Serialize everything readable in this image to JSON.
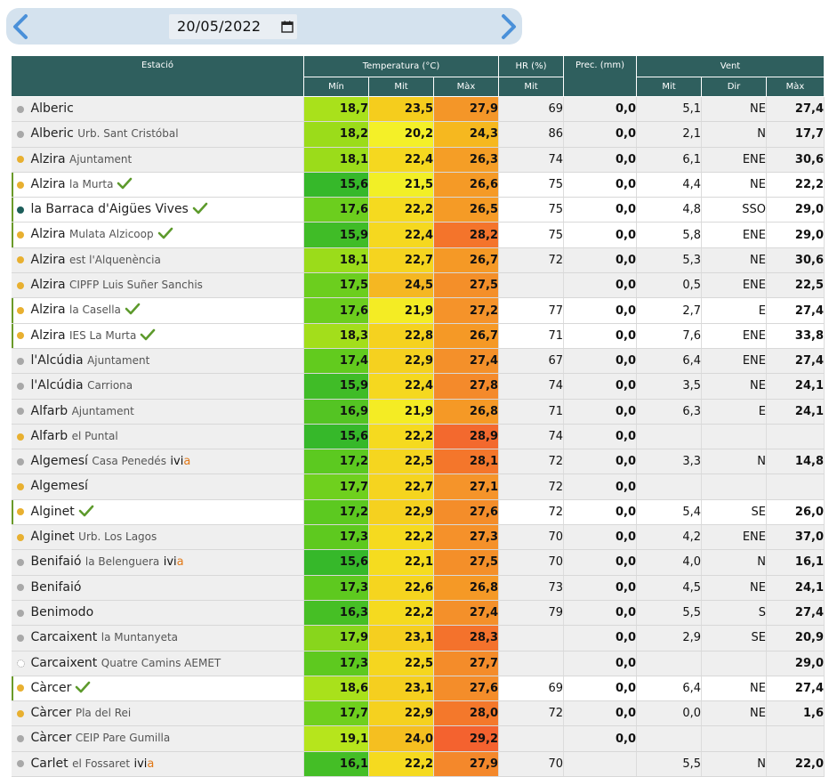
{
  "date_picker": {
    "value": "20/05/2022",
    "prev_icon": "chevron-left-icon",
    "next_icon": "chevron-right-icon",
    "calendar_icon": "calendar-icon",
    "accent_color": "#4a90d9"
  },
  "table": {
    "headers": {
      "station": "Estació",
      "temperature": "Temperatura (°C)",
      "humidity": "HR (%)",
      "precip": "Prec. (mm)",
      "wind": "Vent"
    },
    "subheaders": {
      "temp_min": "Mín",
      "temp_avg": "Mit",
      "temp_max": "Màx",
      "hr_avg": "Mit",
      "wind_avg": "Mit",
      "wind_dir": "Dir",
      "wind_max": "Màx"
    },
    "status_colors": {
      "gray": "#a8a8a8",
      "orange": "#e8b030",
      "teal": "#1d5e5a",
      "empty": "#ffffff"
    },
    "rows": [
      {
        "name": "Alberic",
        "sub": "",
        "status": "gray",
        "sel": false,
        "check": false,
        "ivia": false,
        "min": "18,7",
        "mit": "23,5",
        "max": "27,9",
        "min_color": "#a9e11b",
        "mit_color": "#f5cd1d",
        "max_color": "#f49628",
        "hr": "69",
        "prec": "0,0",
        "wmit": "5,1",
        "wdir": "NE",
        "wmax": "27,4"
      },
      {
        "name": "Alberic",
        "sub": "Urb. Sant Cristóbal",
        "status": "gray",
        "sel": false,
        "check": false,
        "ivia": false,
        "min": "18,2",
        "mit": "20,2",
        "max": "24,3",
        "min_color": "#9bdc1a",
        "mit_color": "#f4f028",
        "max_color": "#f6b81f",
        "hr": "86",
        "prec": "0,0",
        "wmit": "2,1",
        "wdir": "N",
        "wmax": "17,7"
      },
      {
        "name": "Alzira",
        "sub": "Ajuntament",
        "status": "orange",
        "sel": false,
        "check": false,
        "ivia": false,
        "min": "18,1",
        "mit": "22,4",
        "max": "26,3",
        "min_color": "#9bdc1a",
        "mit_color": "#f5d81f",
        "max_color": "#f59e26",
        "hr": "74",
        "prec": "0,0",
        "wmit": "6,1",
        "wdir": "ENE",
        "wmax": "30,6"
      },
      {
        "name": "Alzira",
        "sub": "la Murta",
        "status": "orange",
        "sel": true,
        "check": true,
        "ivia": false,
        "min": "15,6",
        "mit": "21,5",
        "max": "26,6",
        "min_color": "#36b82a",
        "mit_color": "#f2ef26",
        "max_color": "#f59a26",
        "hr": "75",
        "prec": "0,0",
        "wmit": "4,4",
        "wdir": "NE",
        "wmax": "22,2"
      },
      {
        "name": "la Barraca d'Aigües Vives",
        "sub": "",
        "status": "teal",
        "sel": true,
        "check": true,
        "ivia": false,
        "min": "17,6",
        "mit": "22,2",
        "max": "26,5",
        "min_color": "#6cce1e",
        "mit_color": "#f5da1f",
        "max_color": "#f59b26",
        "hr": "75",
        "prec": "0,0",
        "wmit": "4,8",
        "wdir": "SSO",
        "wmax": "29,0"
      },
      {
        "name": "Alzira",
        "sub": "Mulata Alzicoop",
        "status": "orange",
        "sel": true,
        "check": true,
        "ivia": false,
        "min": "15,9",
        "mit": "22,4",
        "max": "28,2",
        "min_color": "#40bc27",
        "mit_color": "#f5d81f",
        "max_color": "#f4742b",
        "hr": "75",
        "prec": "0,0",
        "wmit": "5,8",
        "wdir": "ENE",
        "wmax": "29,0"
      },
      {
        "name": "Alzira",
        "sub": "est l'Alquenència",
        "status": "orange",
        "sel": false,
        "check": false,
        "ivia": false,
        "min": "18,1",
        "mit": "22,7",
        "max": "26,7",
        "min_color": "#9bdc1a",
        "mit_color": "#f5d41f",
        "max_color": "#f59926",
        "hr": "72",
        "prec": "0,0",
        "wmit": "5,3",
        "wdir": "NE",
        "wmax": "30,6"
      },
      {
        "name": "Alzira",
        "sub": "CIPFP Luis Suñer Sanchis",
        "status": "orange",
        "sel": false,
        "check": false,
        "ivia": false,
        "min": "17,5",
        "mit": "24,5",
        "max": "27,5",
        "min_color": "#6cce1e",
        "mit_color": "#f5b722",
        "max_color": "#f48f29",
        "hr": "",
        "prec": "0,0",
        "wmit": "0,5",
        "wdir": "ENE",
        "wmax": "22,5"
      },
      {
        "name": "Alzira",
        "sub": "la Casella",
        "status": "orange",
        "sel": true,
        "check": true,
        "ivia": false,
        "min": "17,6",
        "mit": "21,9",
        "max": "27,2",
        "min_color": "#6cce1e",
        "mit_color": "#f4ec24",
        "max_color": "#f5932a",
        "hr": "77",
        "prec": "0,0",
        "wmit": "2,7",
        "wdir": "E",
        "wmax": "27,4"
      },
      {
        "name": "Alzira",
        "sub": "IES La Murta",
        "status": "orange",
        "sel": true,
        "check": true,
        "ivia": false,
        "min": "18,3",
        "mit": "22,8",
        "max": "26,7",
        "min_color": "#a3de1b",
        "mit_color": "#f5d21f",
        "max_color": "#f59926",
        "hr": "71",
        "prec": "0,0",
        "wmit": "7,6",
        "wdir": "ENE",
        "wmax": "33,8"
      },
      {
        "name": "l'Alcúdia",
        "sub": "Ajuntament",
        "status": "gray",
        "sel": false,
        "check": false,
        "ivia": false,
        "min": "17,4",
        "mit": "22,9",
        "max": "27,4",
        "min_color": "#62cb1e",
        "mit_color": "#f5d11f",
        "max_color": "#f4902a",
        "hr": "67",
        "prec": "0,0",
        "wmit": "6,4",
        "wdir": "ENE",
        "wmax": "27,4"
      },
      {
        "name": "l'Alcúdia",
        "sub": "Carriona",
        "status": "gray",
        "sel": false,
        "check": false,
        "ivia": false,
        "min": "15,9",
        "mit": "22,4",
        "max": "27,8",
        "min_color": "#40bc27",
        "mit_color": "#f5d81f",
        "max_color": "#f48a2b",
        "hr": "74",
        "prec": "0,0",
        "wmit": "3,5",
        "wdir": "NE",
        "wmax": "24,1"
      },
      {
        "name": "Alfarb",
        "sub": "Ajuntament",
        "status": "gray",
        "sel": false,
        "check": false,
        "ivia": false,
        "min": "16,9",
        "mit": "21,9",
        "max": "26,8",
        "min_color": "#54c423",
        "mit_color": "#f4ec24",
        "max_color": "#f59926",
        "hr": "71",
        "prec": "0,0",
        "wmit": "6,3",
        "wdir": "E",
        "wmax": "24,1"
      },
      {
        "name": "Alfarb",
        "sub": "el Puntal",
        "status": "orange",
        "sel": false,
        "check": false,
        "ivia": false,
        "min": "15,6",
        "mit": "22,2",
        "max": "28,9",
        "min_color": "#36b82a",
        "mit_color": "#f5da1f",
        "max_color": "#f3692e",
        "hr": "74",
        "prec": "0,0",
        "wmit": "",
        "wdir": "",
        "wmax": ""
      },
      {
        "name": "Algemesí",
        "sub": "Casa Penedés",
        "status": "gray",
        "sel": false,
        "check": false,
        "ivia": true,
        "min": "17,2",
        "mit": "22,5",
        "max": "28,1",
        "min_color": "#5cc920",
        "mit_color": "#f5d61f",
        "max_color": "#f4762b",
        "hr": "72",
        "prec": "0,0",
        "wmit": "3,3",
        "wdir": "N",
        "wmax": "14,8"
      },
      {
        "name": "Algemesí",
        "sub": "",
        "status": "orange",
        "sel": false,
        "check": false,
        "ivia": false,
        "min": "17,7",
        "mit": "22,7",
        "max": "27,1",
        "min_color": "#6fd01e",
        "mit_color": "#f5d41f",
        "max_color": "#f5942a",
        "hr": "72",
        "prec": "0,0",
        "wmit": "",
        "wdir": "",
        "wmax": ""
      },
      {
        "name": "Alginet",
        "sub": "",
        "status": "orange",
        "sel": true,
        "check": true,
        "ivia": false,
        "min": "17,2",
        "mit": "22,9",
        "max": "27,6",
        "min_color": "#5cc920",
        "mit_color": "#f5d11f",
        "max_color": "#f48d2a",
        "hr": "72",
        "prec": "0,0",
        "wmit": "5,4",
        "wdir": "SE",
        "wmax": "26,0"
      },
      {
        "name": "Alginet",
        "sub": "Urb. Los Lagos",
        "status": "orange",
        "sel": false,
        "check": false,
        "ivia": false,
        "min": "17,3",
        "mit": "22,2",
        "max": "27,3",
        "min_color": "#5ec91f",
        "mit_color": "#f5da1f",
        "max_color": "#f5912a",
        "hr": "70",
        "prec": "0,0",
        "wmit": "4,2",
        "wdir": "ENE",
        "wmax": "37,0"
      },
      {
        "name": "Benifaió",
        "sub": "la Belenguera",
        "status": "gray",
        "sel": false,
        "check": false,
        "ivia": true,
        "min": "15,6",
        "mit": "22,1",
        "max": "27,5",
        "min_color": "#36b82a",
        "mit_color": "#f5dc1f",
        "max_color": "#f48f29",
        "hr": "70",
        "prec": "0,0",
        "wmit": "4,0",
        "wdir": "N",
        "wmax": "16,1"
      },
      {
        "name": "Benifaió",
        "sub": "",
        "status": "gray",
        "sel": false,
        "check": false,
        "ivia": false,
        "min": "17,3",
        "mit": "22,6",
        "max": "26,8",
        "min_color": "#5ec91f",
        "mit_color": "#f5d51f",
        "max_color": "#f59926",
        "hr": "73",
        "prec": "0,0",
        "wmit": "4,5",
        "wdir": "NE",
        "wmax": "24,1"
      },
      {
        "name": "Benimodo",
        "sub": "",
        "status": "gray",
        "sel": false,
        "check": false,
        "ivia": false,
        "min": "16,3",
        "mit": "22,2",
        "max": "27,4",
        "min_color": "#46bf25",
        "mit_color": "#f5da1f",
        "max_color": "#f4902a",
        "hr": "79",
        "prec": "0,0",
        "wmit": "5,5",
        "wdir": "S",
        "wmax": "27,4"
      },
      {
        "name": "Carcaixent",
        "sub": "la Muntanyeta",
        "status": "gray",
        "sel": false,
        "check": false,
        "ivia": false,
        "min": "17,9",
        "mit": "23,1",
        "max": "28,3",
        "min_color": "#88d61c",
        "mit_color": "#f5cf1f",
        "max_color": "#f4722c",
        "hr": "",
        "prec": "0,0",
        "wmit": "2,9",
        "wdir": "SE",
        "wmax": "20,9"
      },
      {
        "name": "Carcaixent",
        "sub": "Quatre Camins AEMET",
        "status": "empty",
        "sel": false,
        "check": false,
        "ivia": false,
        "min": "17,3",
        "mit": "22,5",
        "max": "27,7",
        "min_color": "#5ec91f",
        "mit_color": "#f5d61f",
        "max_color": "#f48c2a",
        "hr": "",
        "prec": "0,0",
        "wmit": "",
        "wdir": "",
        "wmax": "29,0"
      },
      {
        "name": "Càrcer",
        "sub": "",
        "status": "orange",
        "sel": true,
        "check": true,
        "ivia": false,
        "min": "18,6",
        "mit": "23,1",
        "max": "27,6",
        "min_color": "#a9e11b",
        "mit_color": "#f5cf1f",
        "max_color": "#f48d2a",
        "hr": "69",
        "prec": "0,0",
        "wmit": "6,4",
        "wdir": "NE",
        "wmax": "27,4"
      },
      {
        "name": "Càrcer",
        "sub": "Pla del Rei",
        "status": "orange",
        "sel": false,
        "check": false,
        "ivia": false,
        "min": "17,7",
        "mit": "22,9",
        "max": "28,0",
        "min_color": "#6fd01e",
        "mit_color": "#f5d11f",
        "max_color": "#f4782b",
        "hr": "72",
        "prec": "0,0",
        "wmit": "0,0",
        "wdir": "NE",
        "wmax": "1,6"
      },
      {
        "name": "Càrcer",
        "sub": "CEIP Pare Gumilla",
        "status": "gray",
        "sel": false,
        "check": false,
        "ivia": false,
        "min": "19,1",
        "mit": "24,0",
        "max": "29,2",
        "min_color": "#b6e51c",
        "mit_color": "#f5bf20",
        "max_color": "#f4622f",
        "hr": "",
        "prec": "0,0",
        "wmit": "",
        "wdir": "",
        "wmax": ""
      },
      {
        "name": "Carlet",
        "sub": "el Fossaret",
        "status": "gray",
        "sel": false,
        "check": false,
        "ivia": true,
        "min": "16,1",
        "mit": "22,2",
        "max": "27,9",
        "min_color": "#44be26",
        "mit_color": "#f5da1f",
        "max_color": "#f4882b",
        "hr": "70",
        "prec": "",
        "wmit": "5,5",
        "wdir": "N",
        "wmax": "22,0"
      }
    ],
    "ivia_label": {
      "prefix": "ivi",
      "suffix": "a"
    }
  }
}
